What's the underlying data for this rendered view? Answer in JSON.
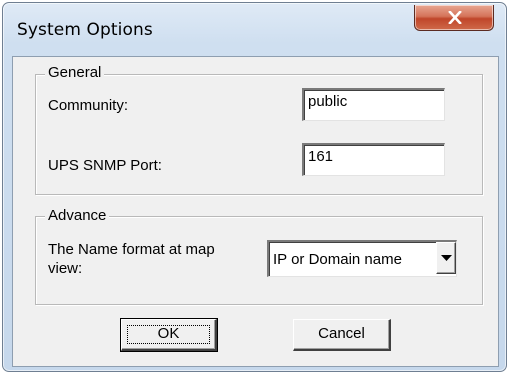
{
  "window": {
    "title": "System Options",
    "close_icon": "close-x-icon"
  },
  "general": {
    "legend": "General",
    "community_label": "Community:",
    "community_value": "public",
    "port_label": "UPS SNMP Port:",
    "port_value": "161"
  },
  "advance": {
    "legend": "Advance",
    "name_format_label_line1": "The Name format at map",
    "name_format_label_line2": "view:",
    "name_format_value": "IP or Domain name",
    "dropdown_icon": "chevron-down-icon"
  },
  "buttons": {
    "ok_label": "OK",
    "cancel_label": "Cancel"
  }
}
